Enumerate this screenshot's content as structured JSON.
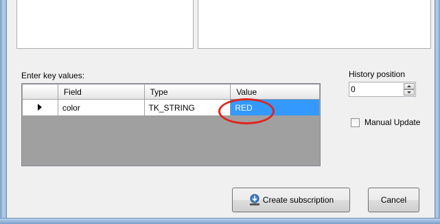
{
  "key_values_label": "Enter key values:",
  "grid": {
    "columns": [
      "Field",
      "Type",
      "Value"
    ],
    "rows": [
      {
        "field": "color",
        "type": "TK_STRING",
        "value": "RED"
      }
    ]
  },
  "history": {
    "label": "History position",
    "value": "0"
  },
  "manual_update": {
    "label": "Manual Update",
    "checked": false
  },
  "buttons": {
    "create_subscription": "Create subscription",
    "cancel": "Cancel"
  },
  "colors": {
    "selection": "#3399ff",
    "highlight_ring": "#e0231c"
  },
  "icons": {
    "create_subscription": "subscription-icon",
    "row_indicator": "row-pointer-icon"
  }
}
